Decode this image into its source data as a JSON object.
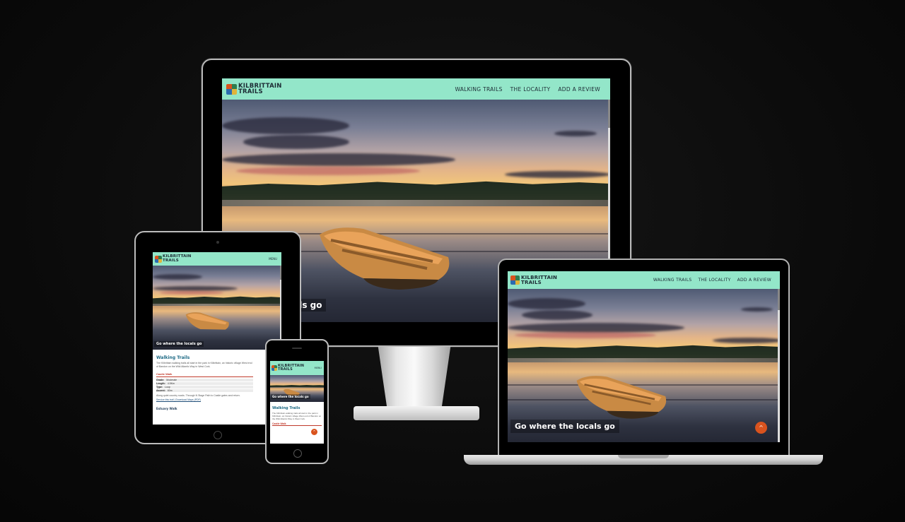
{
  "site": {
    "logo_line1": "KILBRITTAIN",
    "logo_line2": "TRAILS",
    "nav": [
      "WALKING TRAILS",
      "THE LOCALITY",
      "ADD A REVIEW"
    ],
    "menu_label": "MENU",
    "hero_caption": "Go where the locals go",
    "hero_caption_partial": "cals go",
    "scroll_top_glyph": "^"
  },
  "content": {
    "section_title": "Walking Trails",
    "intro": "The Kilbrittain walking trails all start in the park in Kilbrittain, an historic village West end of Bandon on the Wild Atlantic Way in West Cork.",
    "walk1_title": "Castle Walk",
    "walk1_details": [
      {
        "k": "Grade:",
        "v": "Moderate"
      },
      {
        "k": "Length:",
        "v": "4.5Km"
      },
      {
        "k": "Type:",
        "v": "Loop"
      },
      {
        "k": "Ascent:",
        "v": "60m"
      }
    ],
    "walk1_desc": "Along quiet country roads. Through N Stage Path to Castle gates and return.",
    "walk1_links": "Service this trail | Download Maps (PDF)",
    "walk2_title": "Estuary Walk"
  },
  "colors": {
    "nav_bg": "#93e6c9",
    "brand_dark": "#1c2b34",
    "accent_orange": "#d9531e",
    "heading_blue": "#1f6b86",
    "walk_red": "#c0392b"
  }
}
